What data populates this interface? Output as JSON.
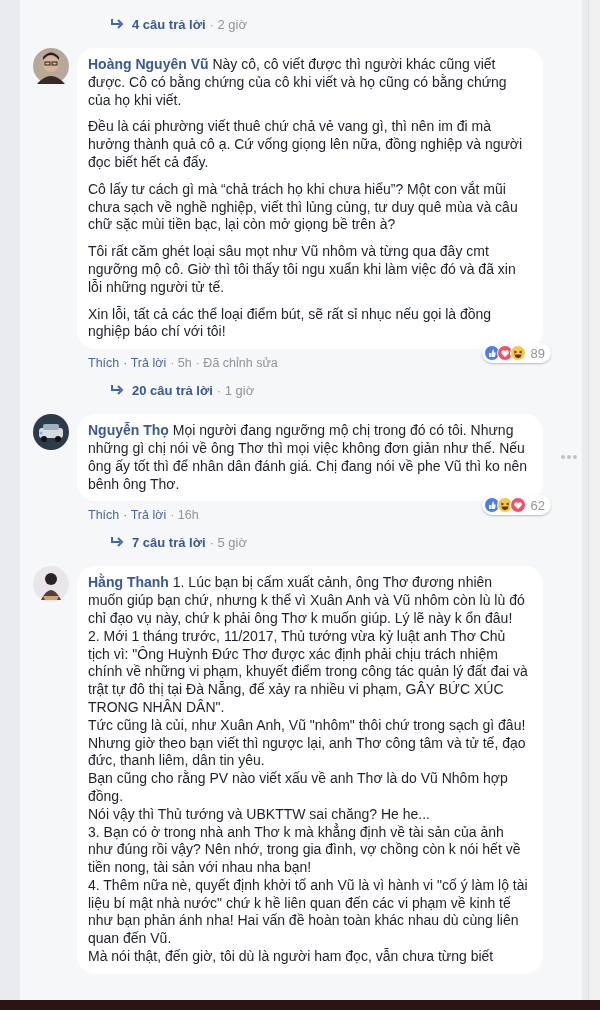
{
  "thread": {
    "replies_link": {
      "count": "4 câu trả lời",
      "time": "· 2 giờ"
    }
  },
  "comments": [
    {
      "author": "Hoàng Nguyên Vũ",
      "kind": "paragraphs",
      "paragraphs": [
        "Này cô, cô viết được thì người khác cũng viết được. Cô có bằng chứng của cô khi viết và họ cũng có bằng chứng của họ khi viết.",
        "Đều là cái phường viết thuê chứ chả vẻ vang gì, thì nên im đi mà hưởng thành quả cô ạ. Cứ vống giọng lên nữa, đồng nghiệp và người đọc biết hết cả đấy.",
        "Cô lấy tư cách gì mà “chả trách họ khi chưa hiểu”? Một con vắt mũi chưa sạch về nghề nghiệp, viết thì lủng củng, tư duy quê mùa và câu chữ sặc mùi tiền bạc, lại còn mở giọng bề trên à?",
        "Tôi rất căm ghét loại sâu mọt như Vũ nhôm và từng qua đây cmt ngưỡng mộ cô. Giờ thì tôi thấy tôi ngu xuẩn khi làm việc đó và đã xin lỗi những người tử tế.",
        "Xin lỗi, tất cả các thể loại điểm bút, sẽ rất sỉ nhục nếu gọi là đồng nghiệp báo chí với tôi!"
      ],
      "options_icon": false,
      "actions": [
        "Thích",
        "· Trả lời"
      ],
      "time": "· 5h",
      "edited": "· Đã chỉnh sửa",
      "reactions": [
        {
          "kind": "like"
        },
        {
          "kind": "love"
        },
        {
          "kind": "haha"
        }
      ],
      "reaction_count": "89",
      "replies_link": {
        "count": "20 câu trả lời",
        "time": "· 1 giờ"
      }
    },
    {
      "author": "Nguyễn Thọ",
      "kind": "paragraphs",
      "paragraphs": [
        "Mọi người đang ngưỡng mộ chị trong đó có tôi. Nhưng những gì chị nói về ông Thơ thì mọi việc không đơn giản như thế. Nếu ông ấy tốt thì để nhân dân đánh giá. Chị đang nói về phe Vũ thì ko nên bênh ông Thơ."
      ],
      "options_icon": true,
      "actions": [
        "Thích",
        "· Trả lời"
      ],
      "time": "· 16h",
      "reactions": [
        {
          "kind": "like"
        },
        {
          "kind": "haha"
        },
        {
          "kind": "love"
        }
      ],
      "reaction_count": "62",
      "replies_link": {
        "count": "7 câu trả lời",
        "time": "· 5 giờ"
      }
    },
    {
      "author": "Hằng Thanh",
      "kind": "lines",
      "paragraphs": [
        "1. Lúc bạn bị cấm xuất cảnh, ông Thơ đương nhiên muốn giúp bạn chứ, nhưng k thể vì Xuân Anh và Vũ nhôm còn lù lù đó chỉ đạo vụ này, chứ k phải ông Thơ k muốn giúp. Lý lẽ này k ổn đâu!",
        "2. Mới 1 tháng trước, 11/2017, Thủ tướng vừa kỷ luật anh Thơ Chủ tịch vì: \"Ông Huỳnh Đức Thơ được xác định phải chịu trách nhiệm chính về những vi phạm, khuyết điểm trong công tác quản lý đất đai và trật tự đô thị tại Đà Nẵng, để xảy ra nhiều vi phạm, GÂY BỨC XÚC TRONG NHÂN DÂN\".",
        "Tức cũng là củi, như Xuân Anh, Vũ \"nhôm\" thôi chứ trong sạch gì đâu!",
        "Nhưng giờ theo bạn viết thì ngược lại, anh Thơ công tâm và tử tế, đạo đức, thanh liêm, dân tin yêu.",
        "Bạn cũng cho rằng PV nào viết xấu về anh Thơ là do Vũ Nhôm hợp đồng.",
        "Nói vậy thì Thủ tướng và UBKTTW sai chăng? He he...",
        "3. Bạn có ở trong nhà anh Thơ k mà khẳng định về tài sản của ảnh như đúng rồi vậy? Nên nhớ, trong gia đình, vợ chồng còn k nói hết về tiền nong, tài sản với nhau nha bạn!",
        "4. Thêm nữa nè, quyết định khởi tố anh Vũ là vì hành vi \"cố ý làm lộ tài liệu bí mật nhà nước\" chứ k hề liên quan đến các vi phạm về kinh tế như bạn phản ánh nha! Hai vấn đề hoàn toàn khác nhau dù cùng liên quan đến Vũ.",
        "Mà nói thật, đến giờ, tôi dù là người ham đọc, vẫn chưa từng biết"
      ],
      "options_icon": false
    }
  ]
}
